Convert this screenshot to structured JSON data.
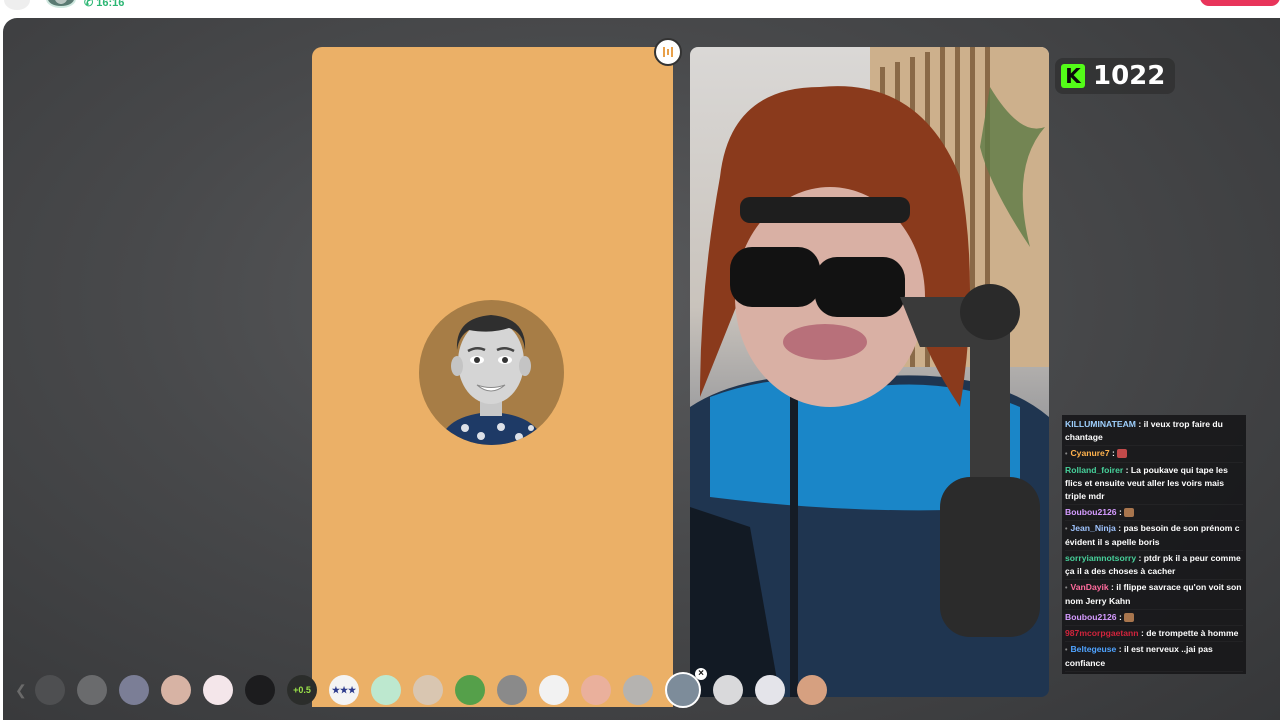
{
  "call": {
    "duration": "16:16"
  },
  "colors": {
    "avatar_bg": "#ebb067",
    "kick_green": "#53fc18",
    "end_call": "#e8345a",
    "stage_bg": "#48494b"
  },
  "kick": {
    "icon": "K",
    "viewer_count": "1022"
  },
  "chat": [
    {
      "user": "KILLUMINATEAM",
      "user_color": "#9fd1ff",
      "text": " : il veux trop faire du chantage",
      "badge": false,
      "sticker": ""
    },
    {
      "user": "Cyanure7",
      "user_color": "#ffb24d",
      "text": " :",
      "badge": true,
      "sticker": "#c24a4a"
    },
    {
      "user": "Rolland_foirer",
      "user_color": "#47d19b",
      "text": " : La poukave qui tape les flics et ensuite veut aller les voirs mais triple mdr",
      "badge": false,
      "sticker": ""
    },
    {
      "user": "Boubou2126",
      "user_color": "#d59bff",
      "text": " :",
      "badge": false,
      "sticker": "#a8754d"
    },
    {
      "user": "Jean_Ninja",
      "user_color": "#9fc4ff",
      "text": " : pas besoin de son prénom c évident il s apelle boris",
      "badge": true,
      "sticker": ""
    },
    {
      "user": "sorryiamnotsorry",
      "user_color": "#47d19b",
      "text": " : ptdr pk il a peur comme ça il a des choses à cacher",
      "badge": false,
      "sticker": ""
    },
    {
      "user": "VanDayik",
      "user_color": "#ff6b9d",
      "text": " : il flippe savrace qu'on voit son nom Jerry Kahn",
      "badge": true,
      "sticker": ""
    },
    {
      "user": "Boubou2126",
      "user_color": "#d59bff",
      "text": " :",
      "badge": false,
      "sticker": "#a8754d"
    },
    {
      "user": "987mcorpgaetann",
      "user_color": "#d0243c",
      "text": " : de trompette à homme",
      "badge": false,
      "sticker": ""
    },
    {
      "user": "Beltegeuse",
      "user_color": "#4fa3ff",
      "text": " : il est nerveux ..jai pas confiance",
      "badge": true,
      "sticker": ""
    }
  ],
  "filters": [
    {
      "name": "face-filter-1",
      "color": "#4e4f51",
      "label": ""
    },
    {
      "name": "face-filter-2",
      "color": "#6a6b6d",
      "label": ""
    },
    {
      "name": "face-filter-3",
      "color": "#7b7e96",
      "label": ""
    },
    {
      "name": "face-filter-4",
      "color": "#d7b3a4",
      "label": ""
    },
    {
      "name": "face-filter-5",
      "color": "#f4e6ea",
      "label": ""
    },
    {
      "name": "face-filter-6",
      "color": "#1c1c1e",
      "label": ""
    },
    {
      "name": "face-filter-7",
      "color": "#2b2d2b",
      "label": "+0.5"
    },
    {
      "name": "face-filter-8",
      "color": "#f4f4f4",
      "label": "★★★"
    },
    {
      "name": "face-filter-9",
      "color": "#bde8cf",
      "label": ""
    },
    {
      "name": "face-filter-10",
      "color": "#d9c6b1",
      "label": ""
    },
    {
      "name": "face-filter-11",
      "color": "#55a04a",
      "label": ""
    },
    {
      "name": "face-filter-12",
      "color": "#8a8a8a",
      "label": ""
    },
    {
      "name": "face-filter-13",
      "color": "#f2f2f2",
      "label": ""
    },
    {
      "name": "face-filter-14",
      "color": "#eab09c",
      "label": ""
    },
    {
      "name": "face-filter-15",
      "color": "#b5b3b0",
      "label": ""
    },
    {
      "name": "face-filter-16",
      "color": "#7d8c9a",
      "label": "",
      "selected": true
    },
    {
      "name": "face-filter-17",
      "color": "#d9d9db",
      "label": ""
    },
    {
      "name": "face-filter-18",
      "color": "#e4e4ea",
      "label": ""
    },
    {
      "name": "face-filter-19",
      "color": "#d6a080",
      "label": ""
    }
  ]
}
